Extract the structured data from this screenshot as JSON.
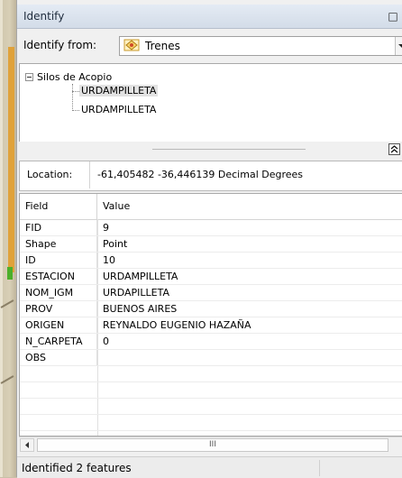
{
  "window": {
    "title": "Identify",
    "pin_glyph": "□"
  },
  "identify_from": {
    "label": "Identify from:",
    "selected": "Trenes",
    "icon": "layer-icon"
  },
  "tree": {
    "group": "Silos de Acopio",
    "items": [
      "URDAMPILLETA",
      "URDAMPILLETA"
    ],
    "selected_index": 0
  },
  "location": {
    "label": "Location:",
    "value": "-61,405482  -36,446139 Decimal Degrees"
  },
  "grid": {
    "columns": [
      "Field",
      "Value"
    ],
    "rows": [
      {
        "field": "FID",
        "value": "9"
      },
      {
        "field": "Shape",
        "value": "Point"
      },
      {
        "field": "ID",
        "value": "10"
      },
      {
        "field": "ESTACION",
        "value": "URDAMPILLETA"
      },
      {
        "field": "NOM_IGM",
        "value": "URDAPILLETA"
      },
      {
        "field": "PROV",
        "value": "BUENOS AIRES"
      },
      {
        "field": "ORIGEN",
        "value": "REYNALDO EUGENIO HAZAÑA"
      },
      {
        "field": "N_CARPETA",
        "value": "0"
      },
      {
        "field": "OBS",
        "value": ""
      }
    ]
  },
  "scrollbar": {
    "thumb_glyph": "III"
  },
  "status": {
    "text": "Identified 2 features"
  }
}
